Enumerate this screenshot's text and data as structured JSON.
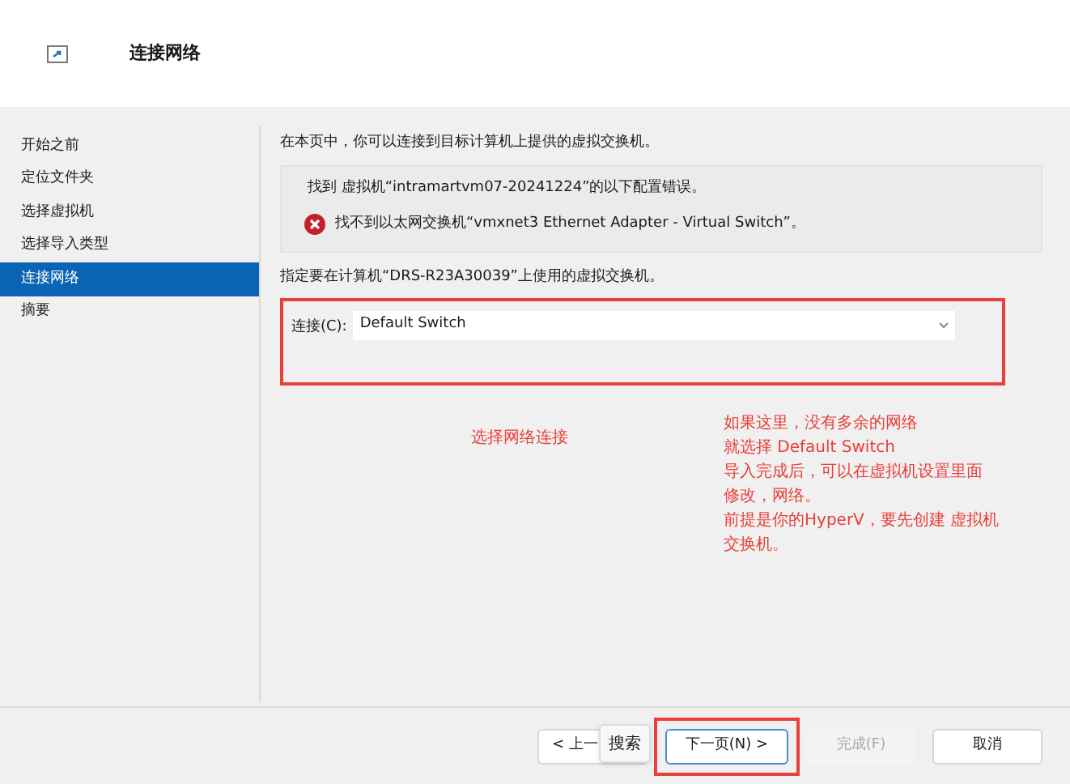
{
  "header": {
    "title": "连接网络"
  },
  "steps": [
    {
      "label": "开始之前",
      "selected": false
    },
    {
      "label": "定位文件夹",
      "selected": false
    },
    {
      "label": "选择虚拟机",
      "selected": false
    },
    {
      "label": "选择导入类型",
      "selected": false
    },
    {
      "label": "连接网络",
      "selected": true
    },
    {
      "label": "摘要",
      "selected": false
    }
  ],
  "intro": "在本页中，你可以连接到目标计算机上提供的虚拟交换机。",
  "error_box": {
    "heading": "找到 虚拟机“intramartvm07-20241224”的以下配置错误。",
    "errors": [
      "找不到以太网交换机“vmxnet3 Ethernet Adapter - Virtual Switch”。"
    ]
  },
  "target_text": "指定要在计算机“DRS-R23A30039”上使用的虚拟交换机。",
  "connection": {
    "label": "连接(C):",
    "value": "Default Switch"
  },
  "annotations": {
    "label": "选择网络连接",
    "note_lines": [
      "如果这里，没有多余的网络",
      "就选择 Default Switch",
      "导入完成后，可以在虚拟机设置里面",
      "修改，网络。",
      "前提是你的HyperV，要先创建 虚拟机",
      "交换机。"
    ]
  },
  "buttons": [
    {
      "label": "< 上一",
      "disabled": false,
      "focused": false
    },
    {
      "label": "下一页(N) >",
      "disabled": false,
      "focused": true
    },
    {
      "label": "完成(F)",
      "disabled": true,
      "focused": false
    },
    {
      "label": "取消",
      "disabled": false,
      "focused": false
    }
  ],
  "tooltip": "搜索"
}
